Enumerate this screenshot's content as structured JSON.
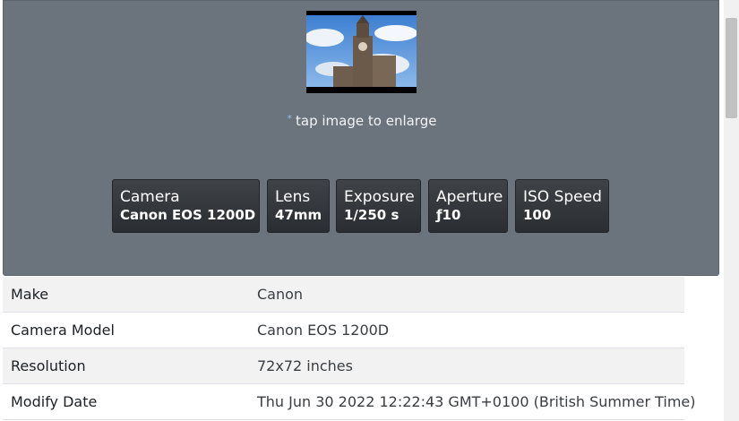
{
  "preview": {
    "hint_text": "tap image to enlarge",
    "hint_dot": "*"
  },
  "stats": [
    {
      "label": "Camera",
      "value": "Canon EOS 1200D"
    },
    {
      "label": "Lens",
      "value": "47mm"
    },
    {
      "label": "Exposure",
      "value": "1/250 s"
    },
    {
      "label": "Aperture",
      "value": "ƒ10"
    },
    {
      "label": "ISO Speed",
      "value": "100"
    }
  ],
  "details": [
    {
      "key": "Make",
      "value": "Canon"
    },
    {
      "key": "Camera Model",
      "value": "Canon EOS 1200D"
    },
    {
      "key": "Resolution",
      "value": "72x72 inches"
    },
    {
      "key": "Modify Date",
      "value": "Thu Jun 30 2022 12:22:43 GMT+0100 (British Summer Time)"
    }
  ],
  "colors": {
    "panel_bg": "#6b737c",
    "stat_box_bg": "#2a2d31",
    "hint_dot": "#8fc2f0"
  }
}
